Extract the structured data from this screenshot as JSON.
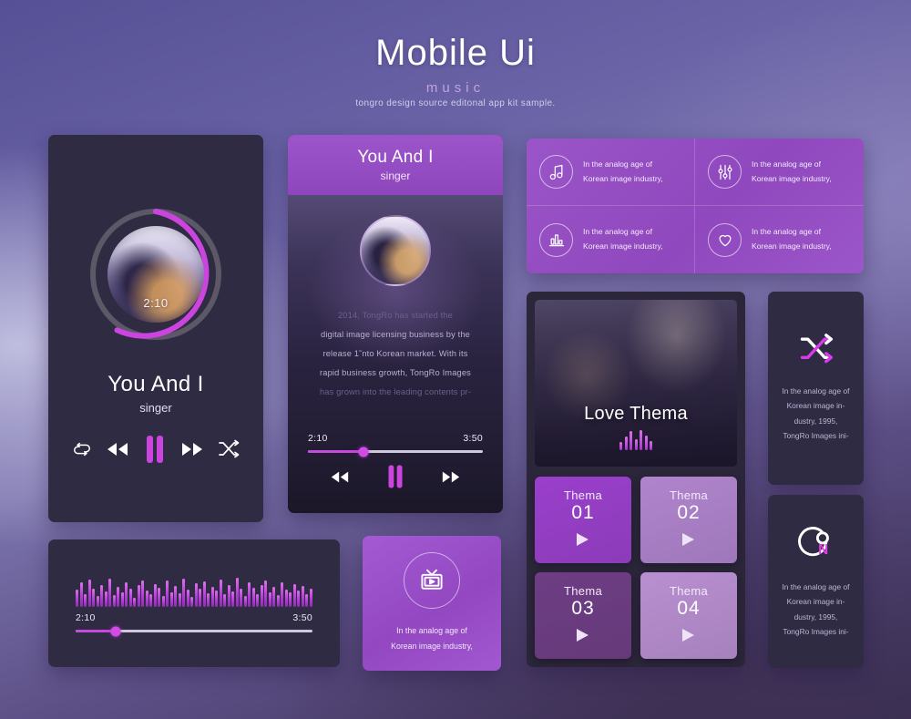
{
  "header": {
    "title": "Mobile Ui",
    "subtitle": "music",
    "description": "tongro design source editonal app kit sample."
  },
  "colors": {
    "accent_purple": "#9147bd",
    "accent_magenta": "#cb44e0",
    "card_dark": "#2f2b42",
    "background_top": "#565096"
  },
  "player_circle": {
    "time_label": "2:10",
    "title": "You And I",
    "subtitle": "singer",
    "progress_percent": 68,
    "controls": [
      {
        "name": "repeat-icon",
        "label": "repeat"
      },
      {
        "name": "rewind-icon",
        "label": "rewind"
      },
      {
        "name": "pause-icon",
        "label": "pause"
      },
      {
        "name": "forward-icon",
        "label": "forward"
      },
      {
        "name": "shuffle-icon",
        "label": "shuffle"
      }
    ]
  },
  "player_detail": {
    "title": "You And I",
    "subtitle": "singer",
    "body_line_1": "2014, TongRo has started the",
    "body_line_2": "digital image licensing business by the",
    "body_line_3": "release 1˜nto Korean market. With its",
    "body_line_4": "rapid business growth, TongRo Images",
    "body_line_5": "has grown into the leading contents pr-",
    "time_current": "2:10",
    "time_total": "3:50",
    "progress_percent": 32,
    "controls": [
      {
        "name": "rewind-icon",
        "label": "rewind"
      },
      {
        "name": "pause-icon",
        "label": "pause"
      },
      {
        "name": "forward-icon",
        "label": "forward"
      }
    ]
  },
  "feature_grid": {
    "items": [
      {
        "icon": "music-note-icon",
        "line1": "In the analog age of",
        "line2": "Korean image industry,"
      },
      {
        "icon": "equalizer-sliders-icon",
        "line1": "In the analog age of",
        "line2": "Korean image industry,"
      },
      {
        "icon": "bar-chart-icon",
        "line1": "In the analog age of",
        "line2": "Korean image industry,"
      },
      {
        "icon": "heart-icon",
        "line1": "In the analog age of",
        "line2": "Korean image industry,"
      }
    ]
  },
  "love_thema": {
    "title": "Love Thema",
    "waveform_icon": "audio-waveform-icon",
    "themes": [
      {
        "label": "Thema",
        "number": "01",
        "color": "#9a3fcc"
      },
      {
        "label": "Thema",
        "number": "02",
        "color": "#b084cd"
      },
      {
        "label": "Thema",
        "number": "03",
        "color": "#6e3d84"
      },
      {
        "label": "Thema",
        "number": "04",
        "color": "#b98fd0"
      }
    ]
  },
  "side_cards": [
    {
      "icon": "shuffle-icon",
      "line1": "In the analog age of",
      "line2": "Korean image in-",
      "line3": "dustry, 1995,",
      "line4": "TongRo Images ini-"
    },
    {
      "icon": "repeat-on-icon",
      "line1": "In the analog age of",
      "line2": "Korean image in-",
      "line3": "dustry, 1995,",
      "line4": "TongRo Images ini-"
    }
  ],
  "wave_card": {
    "time_current": "2:10",
    "time_total": "3:50",
    "progress_percent": 17
  },
  "tv_card": {
    "icon": "tv-play-icon",
    "line1": "In the analog age of",
    "line2": "Korean image industry,"
  },
  "chart_data": {
    "type": "bar",
    "title": "Audio waveform visualizer",
    "categories": [
      "1",
      "2",
      "3",
      "4",
      "5",
      "6",
      "7",
      "8",
      "9",
      "10",
      "11",
      "12",
      "13",
      "14",
      "15",
      "16",
      "17",
      "18",
      "19",
      "20",
      "21",
      "22",
      "23",
      "24",
      "25",
      "26",
      "27",
      "28",
      "29",
      "30",
      "31",
      "32",
      "33",
      "34",
      "35",
      "36",
      "37",
      "38",
      "39",
      "40",
      "41",
      "42",
      "43",
      "44",
      "45",
      "46",
      "47",
      "48",
      "49",
      "50",
      "51",
      "52",
      "53",
      "54",
      "55",
      "56",
      "57",
      "58"
    ],
    "values": [
      55,
      78,
      42,
      88,
      60,
      34,
      72,
      50,
      90,
      38,
      64,
      46,
      80,
      58,
      30,
      70,
      86,
      52,
      40,
      74,
      62,
      36,
      84,
      48,
      68,
      44,
      92,
      56,
      32,
      76,
      60,
      82,
      45,
      66,
      54,
      88,
      40,
      72,
      50,
      94,
      58,
      36,
      78,
      62,
      42,
      70,
      85,
      48,
      64,
      38,
      80,
      56,
      46,
      74,
      52,
      68,
      42,
      60
    ],
    "ylabel": "",
    "xlabel": "",
    "ylim": [
      0,
      100
    ]
  }
}
